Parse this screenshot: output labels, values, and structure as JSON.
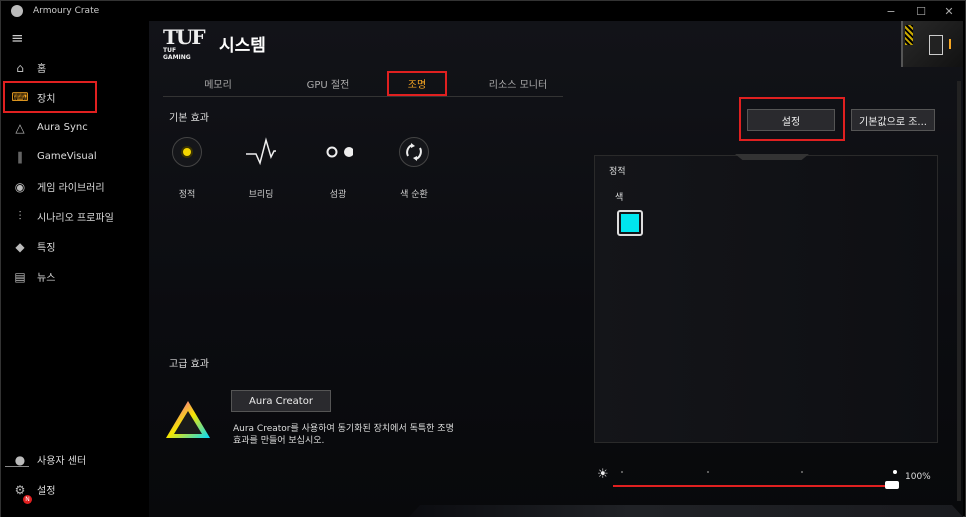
{
  "window": {
    "title": "Armoury Crate",
    "controls": [
      "−",
      "☐",
      "✕"
    ]
  },
  "sidebar": {
    "menu_icon": "hamburger-icon",
    "items": [
      {
        "label": "홈",
        "icon": "home-icon",
        "glyph": "⌂"
      },
      {
        "label": "장치",
        "icon": "keyboard-icon",
        "glyph": "⌨",
        "active": true
      },
      {
        "label": "Aura Sync",
        "icon": "triangle-icon",
        "glyph": "△"
      },
      {
        "label": "GameVisual",
        "icon": "gamevisual-icon",
        "glyph": "∥"
      },
      {
        "label": "게임 라이브러리",
        "icon": "gamepad-icon",
        "glyph": "◉"
      },
      {
        "label": "시나리오 프로파일",
        "icon": "sliders-icon",
        "glyph": "⫶"
      },
      {
        "label": "특징",
        "icon": "tag-icon",
        "glyph": "◆"
      },
      {
        "label": "뉴스",
        "icon": "news-icon",
        "glyph": "▤"
      }
    ],
    "bottom": [
      {
        "label": "사용자 센터",
        "icon": "user-icon",
        "glyph": "●"
      },
      {
        "label": "설정",
        "icon": "gear-icon",
        "glyph": "⚙",
        "badge": "N"
      }
    ]
  },
  "header": {
    "brand": "TUF GAMING",
    "title": "시스템"
  },
  "tabs": [
    {
      "label": "메모리"
    },
    {
      "label": "GPU 절전"
    },
    {
      "label": "조명",
      "active": true
    },
    {
      "label": "리소스 모니터"
    }
  ],
  "basic_effects": {
    "title": "기본 효과",
    "items": [
      {
        "label": "정적",
        "icon": "static-icon"
      },
      {
        "label": "브리딩",
        "icon": "breathing-icon"
      },
      {
        "label": "섬광",
        "icon": "strobing-icon"
      },
      {
        "label": "색 순환",
        "icon": "color-cycle-icon"
      }
    ]
  },
  "advanced_effects": {
    "title": "고급 효과",
    "button": "Aura Creator",
    "description": "Aura Creator를 사용하여 동기화된 장치에서 독특한 조명 효과를 만들어 보십시오."
  },
  "actions": {
    "settings": "설정",
    "reset": "기본값으로 조..."
  },
  "panel": {
    "mode": "정적",
    "color_label": "색",
    "color": "#00e5ee"
  },
  "brightness": {
    "value": 100,
    "label": "100%"
  },
  "colors": {
    "accent": "#f5a623",
    "highlight": "#e02020"
  }
}
